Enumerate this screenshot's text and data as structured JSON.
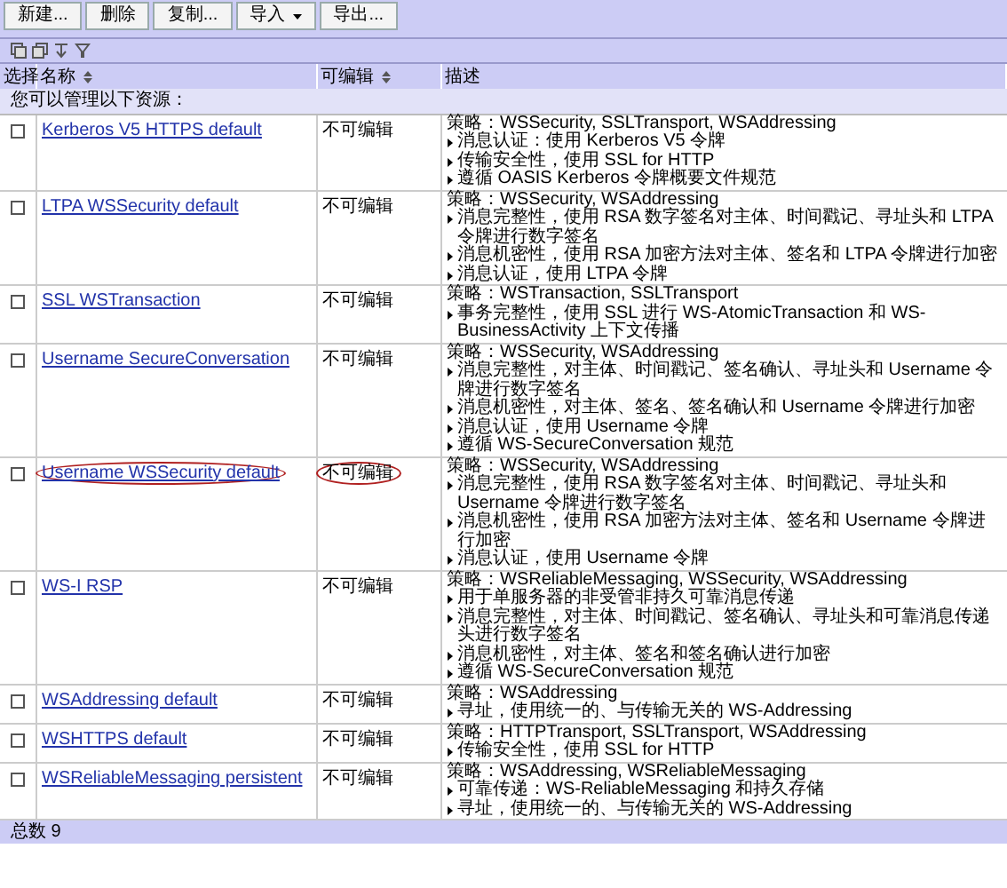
{
  "toolbar": {
    "buttons": [
      {
        "label": "新建...",
        "kind": "plain"
      },
      {
        "label": "删除",
        "kind": "plain"
      },
      {
        "label": "复制...",
        "kind": "plain"
      },
      {
        "label": "导入",
        "kind": "menu"
      },
      {
        "label": "导出...",
        "kind": "plain"
      }
    ]
  },
  "table": {
    "columns": [
      {
        "label": "选择",
        "sortable": false
      },
      {
        "label": "名称",
        "sortable": true
      },
      {
        "label": "可编辑",
        "sortable": true
      },
      {
        "label": "描述",
        "sortable": false
      }
    ],
    "info": "您可以管理以下资源：",
    "rows": [
      {
        "checked": false,
        "circled": false,
        "name": "Kerberos V5 HTTPS default",
        "editable": "不可编辑",
        "policy": "策略：WSSecurity, SSLTransport, WSAddressing",
        "items": [
          "消息认证：使用 Kerberos V5 令牌",
          "传输安全性，使用 SSL for HTTP",
          "遵循 OASIS Kerberos 令牌概要文件规范"
        ]
      },
      {
        "checked": false,
        "circled": false,
        "name": "LTPA WSSecurity default",
        "editable": "不可编辑",
        "policy": "策略：WSSecurity, WSAddressing",
        "items": [
          "消息完整性，使用 RSA 数字签名对主体、时间戳记、寻址头和 LTPA 令牌进行数字签名",
          "消息机密性，使用 RSA 加密方法对主体、签名和 LTPA 令牌进行加密",
          "消息认证，使用 LTPA 令牌"
        ]
      },
      {
        "checked": false,
        "circled": false,
        "name": "SSL WSTransaction",
        "editable": "不可编辑",
        "policy": "策略：WSTransaction, SSLTransport",
        "items": [
          "事务完整性，使用 SSL 进行 WS-AtomicTransaction 和 WS-BusinessActivity 上下文传播"
        ]
      },
      {
        "checked": false,
        "circled": false,
        "name": "Username SecureConversation",
        "editable": "不可编辑",
        "policy": "策略：WSSecurity, WSAddressing",
        "items": [
          "消息完整性，对主体、时间戳记、签名确认、寻址头和 Username 令牌进行数字签名",
          "消息机密性，对主体、签名、签名确认和 Username 令牌进行加密",
          "消息认证，使用 Username 令牌",
          "遵循 WS-SecureConversation 规范"
        ]
      },
      {
        "checked": false,
        "circled": true,
        "name": "Username WSSecurity default",
        "editable": "不可编辑",
        "policy": "策略：WSSecurity, WSAddressing",
        "items": [
          "消息完整性，使用 RSA 数字签名对主体、时间戳记、寻址头和 Username 令牌进行数字签名",
          "消息机密性，使用 RSA 加密方法对主体、签名和 Username 令牌进行加密",
          "消息认证，使用 Username 令牌"
        ]
      },
      {
        "checked": false,
        "circled": false,
        "name": "WS-I RSP",
        "editable": "不可编辑",
        "policy": "策略：WSReliableMessaging, WSSecurity, WSAddressing",
        "items": [
          "用于单服务器的非受管非持久可靠消息传递",
          "消息完整性，对主体、时间戳记、签名确认、寻址头和可靠消息传递头进行数字签名",
          "消息机密性，对主体、签名和签名确认进行加密",
          "遵循 WS-SecureConversation 规范"
        ]
      },
      {
        "checked": false,
        "circled": false,
        "name": "WSAddressing default",
        "editable": "不可编辑",
        "policy": "策略：WSAddressing",
        "items": [
          "寻址，使用统一的、与传输无关的 WS-Addressing"
        ]
      },
      {
        "checked": false,
        "circled": false,
        "name": "WSHTTPS default",
        "editable": "不可编辑",
        "policy": "策略：HTTPTransport, SSLTransport, WSAddressing",
        "items": [
          "传输安全性，使用 SSL for HTTP"
        ]
      },
      {
        "checked": false,
        "circled": false,
        "name": "WSReliableMessaging persistent",
        "editable": "不可编辑",
        "policy": "策略：WSAddressing, WSReliableMessaging",
        "items": [
          "可靠传递：WS-ReliableMessaging 和持久存储",
          "寻址，使用统一的、与传输无关的 WS-Addressing"
        ]
      }
    ],
    "total": "总数 9"
  }
}
